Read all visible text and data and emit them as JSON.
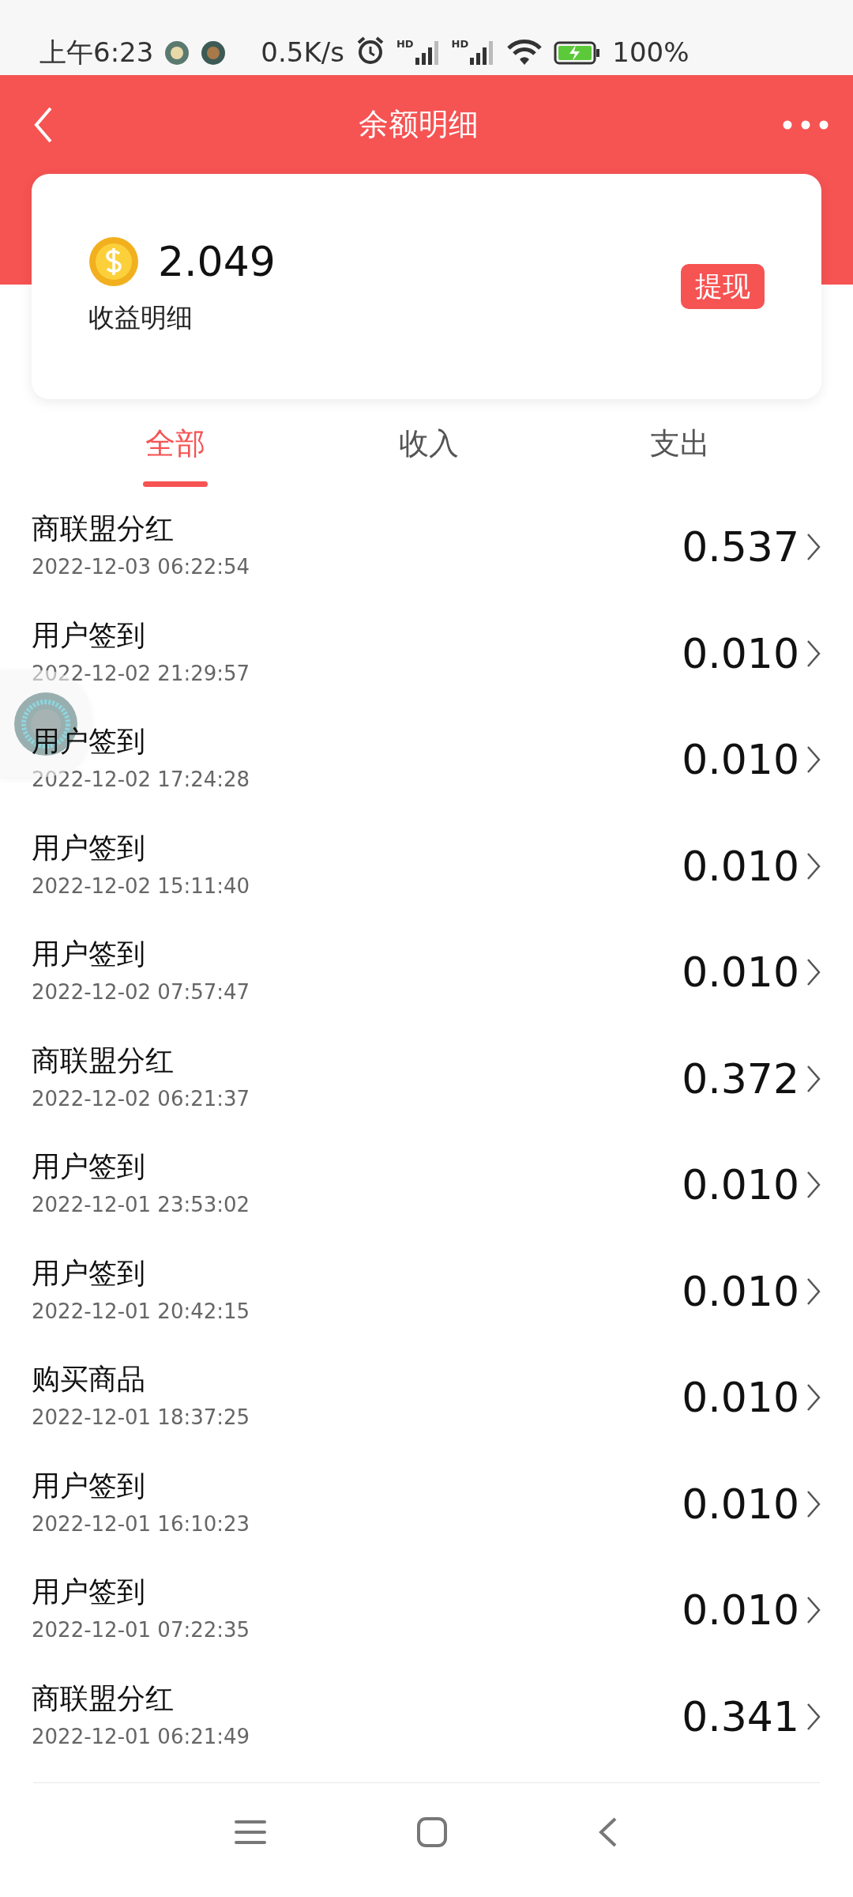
{
  "status_bar": {
    "time": "上午6:23",
    "net_speed": "0.5K/s",
    "signals": [
      {
        "label": "HD"
      },
      {
        "label": "HD"
      }
    ],
    "battery": "100%"
  },
  "header": {
    "title": "余额明细"
  },
  "balance_card": {
    "amount": "2.049",
    "label": "收益明细",
    "button": "提现"
  },
  "tabs": [
    {
      "label": "全部",
      "selected": true
    },
    {
      "label": "收入",
      "selected": false
    },
    {
      "label": "支出",
      "selected": false
    }
  ],
  "records": [
    {
      "title": "商联盟分红",
      "time": "2022-12-03 06:22:54",
      "amount": "0.537"
    },
    {
      "title": "用户签到",
      "time": "2022-12-02 21:29:57",
      "amount": "0.010"
    },
    {
      "title": "用户签到",
      "time": "2022-12-02 17:24:28",
      "amount": "0.010"
    },
    {
      "title": "用户签到",
      "time": "2022-12-02 15:11:40",
      "amount": "0.010"
    },
    {
      "title": "用户签到",
      "time": "2022-12-02 07:57:47",
      "amount": "0.010"
    },
    {
      "title": "商联盟分红",
      "time": "2022-12-02 06:21:37",
      "amount": "0.372"
    },
    {
      "title": "用户签到",
      "time": "2022-12-01 23:53:02",
      "amount": "0.010"
    },
    {
      "title": "用户签到",
      "time": "2022-12-01 20:42:15",
      "amount": "0.010"
    },
    {
      "title": "购买商品",
      "time": "2022-12-01 18:37:25",
      "amount": "0.010"
    },
    {
      "title": "用户签到",
      "time": "2022-12-01 16:10:23",
      "amount": "0.010"
    },
    {
      "title": "用户签到",
      "time": "2022-12-01 07:22:35",
      "amount": "0.010"
    },
    {
      "title": "商联盟分红",
      "time": "2022-12-01 06:21:49",
      "amount": "0.341"
    }
  ]
}
